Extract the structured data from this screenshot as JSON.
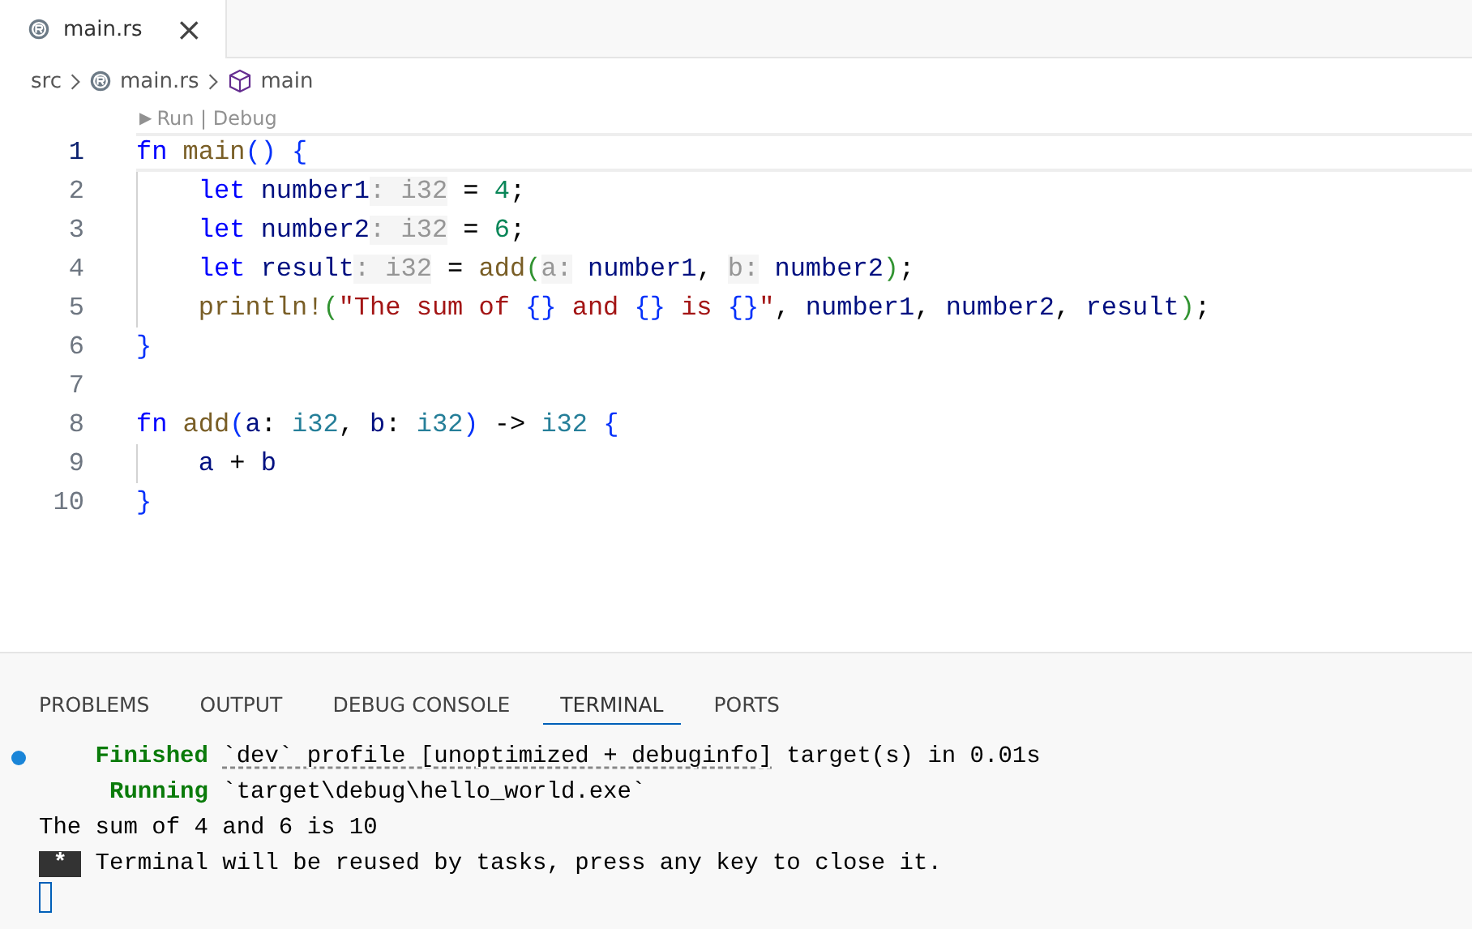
{
  "tabs": [
    {
      "label": "main.rs",
      "selected": true,
      "close": "×"
    }
  ],
  "breadcrumb": [
    {
      "label": "src",
      "kind": "folder"
    },
    {
      "label": "main.rs",
      "kind": "file"
    },
    {
      "label": "main",
      "kind": "symbol"
    }
  ],
  "codelens": {
    "arrow": "▶",
    "text": "Run | Debug"
  },
  "code": [
    {
      "number": "1",
      "current": true,
      "tokens": [
        {
          "kind": "kw",
          "t": "fn"
        },
        {
          "kind": "fn",
          "t": " main"
        },
        {
          "kind": "br",
          "t": "()"
        },
        {
          "kind": "br",
          "t": " {"
        }
      ]
    },
    {
      "number": "2",
      "current": false,
      "tokens": [
        {
          "kind": "kw",
          "t": "    let"
        },
        {
          "kind": "var",
          "t": " number1"
        },
        {
          "kind": "hint",
          "t": ": i32"
        },
        {
          "kind": "p",
          "t": " = "
        },
        {
          "kind": "num",
          "t": "4"
        },
        {
          "kind": "p",
          "t": ";"
        }
      ]
    },
    {
      "number": "3",
      "current": false,
      "tokens": [
        {
          "kind": "kw",
          "t": "    let"
        },
        {
          "kind": "var",
          "t": " number2"
        },
        {
          "kind": "hint",
          "t": ": i32"
        },
        {
          "kind": "p",
          "t": " = "
        },
        {
          "kind": "num",
          "t": "6"
        },
        {
          "kind": "p",
          "t": ";"
        }
      ]
    },
    {
      "number": "4",
      "current": false,
      "tokens": [
        {
          "kind": "kw",
          "t": "    let"
        },
        {
          "kind": "var",
          "t": " result"
        },
        {
          "kind": "hint",
          "t": ": i32"
        },
        {
          "kind": "p",
          "t": " = "
        },
        {
          "kind": "fn",
          "t": "add"
        },
        {
          "kind": "br2",
          "t": "("
        },
        {
          "kind": "hint",
          "t": "a:"
        },
        {
          "kind": "var",
          "t": " number1"
        },
        {
          "kind": "p",
          "t": ", "
        },
        {
          "kind": "hint",
          "t": "b:"
        },
        {
          "kind": "var",
          "t": " number2"
        },
        {
          "kind": "br2",
          "t": ")"
        },
        {
          "kind": "p",
          "t": ";"
        }
      ]
    },
    {
      "number": "5",
      "current": false,
      "tokens": [
        {
          "kind": "macro",
          "t": "    println!"
        },
        {
          "kind": "br2",
          "t": "("
        },
        {
          "kind": "str",
          "t": "\"The sum of "
        },
        {
          "kind": "br",
          "t": "{}"
        },
        {
          "kind": "str",
          "t": " and "
        },
        {
          "kind": "br",
          "t": "{}"
        },
        {
          "kind": "str",
          "t": " is "
        },
        {
          "kind": "br",
          "t": "{}"
        },
        {
          "kind": "str",
          "t": "\""
        },
        {
          "kind": "p",
          "t": ", "
        },
        {
          "kind": "var",
          "t": "number1"
        },
        {
          "kind": "p",
          "t": ", "
        },
        {
          "kind": "var",
          "t": "number2"
        },
        {
          "kind": "p",
          "t": ", "
        },
        {
          "kind": "var",
          "t": "result"
        },
        {
          "kind": "br2",
          "t": ")"
        },
        {
          "kind": "p",
          "t": ";"
        }
      ]
    },
    {
      "number": "6",
      "current": false,
      "tokens": [
        {
          "kind": "br",
          "t": "}"
        }
      ]
    },
    {
      "number": "7",
      "current": false
    },
    {
      "number": "8",
      "current": false,
      "tokens": [
        {
          "kind": "kw",
          "t": "fn"
        },
        {
          "kind": "fn",
          "t": " add"
        },
        {
          "kind": "br",
          "t": "("
        },
        {
          "kind": "var",
          "t": "a"
        },
        {
          "kind": "p",
          "t": ": "
        },
        {
          "kind": "type",
          "t": "i32"
        },
        {
          "kind": "p",
          "t": ", "
        },
        {
          "kind": "var",
          "t": "b"
        },
        {
          "kind": "p",
          "t": ": "
        },
        {
          "kind": "type",
          "t": "i32"
        },
        {
          "kind": "br",
          "t": ")"
        },
        {
          "kind": "p",
          "t": " -> "
        },
        {
          "kind": "type",
          "t": "i32"
        },
        {
          "kind": "br",
          "t": " {"
        }
      ]
    },
    {
      "number": "9",
      "current": false,
      "tokens": [
        {
          "kind": "var",
          "t": "    a"
        },
        {
          "kind": "p",
          "t": " + "
        },
        {
          "kind": "var",
          "t": "b"
        }
      ]
    },
    {
      "number": "10",
      "current": false,
      "tokens": [
        {
          "kind": "br",
          "t": "}"
        }
      ]
    }
  ],
  "panel_tabs": [
    {
      "label": "PROBLEMS",
      "selected": false
    },
    {
      "label": "OUTPUT",
      "selected": false
    },
    {
      "label": "DEBUG CONSOLE",
      "selected": false
    },
    {
      "label": "TERMINAL",
      "selected": true
    },
    {
      "label": "PORTS",
      "selected": false
    }
  ],
  "terminal": [
    {
      "marker": true,
      "segments": [
        {
          "kind": "status",
          "t": "    Finished "
        },
        {
          "kind": "link",
          "t": "`dev` profile [unoptimized + debuginfo]"
        },
        {
          "kind": "p",
          "t": " target(s) in 0.01s"
        }
      ]
    },
    {
      "marker": false,
      "segments": [
        {
          "kind": "status",
          "t": "     Running"
        },
        {
          "kind": "p",
          "t": " `target\\debug\\hello_world.exe`"
        }
      ]
    },
    {
      "marker": false,
      "segments": [
        {
          "kind": "p",
          "t": "The sum of 4 and 6 is 10"
        }
      ]
    },
    {
      "marker": false,
      "segments": [
        {
          "kind": "badge",
          "t": " * "
        },
        {
          "kind": "p",
          "t": " Terminal will be reused by tasks, press any key to close it."
        }
      ]
    }
  ]
}
